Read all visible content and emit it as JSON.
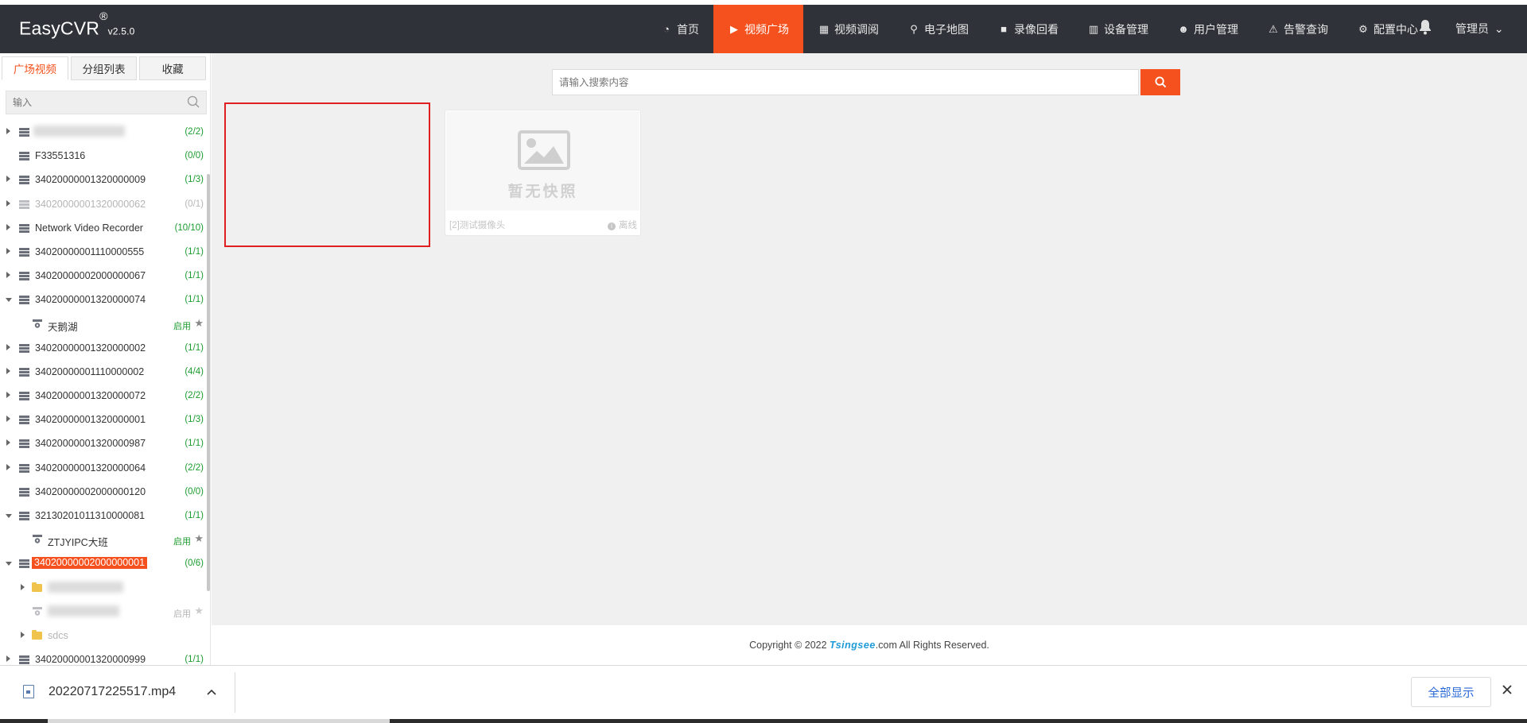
{
  "app": {
    "name": "EasyCVR",
    "reg": "®",
    "version": "v2.5.0"
  },
  "nav": [
    {
      "label": "首页",
      "icon": "dashboard-icon",
      "glyph": "◔"
    },
    {
      "label": "视频广场",
      "icon": "play-circle-icon",
      "glyph": "▶",
      "active": true
    },
    {
      "label": "视频调阅",
      "icon": "table-icon",
      "glyph": "▦"
    },
    {
      "label": "电子地图",
      "icon": "map-pin-icon",
      "glyph": "⚲"
    },
    {
      "label": "录像回看",
      "icon": "video-camera-icon",
      "glyph": "■"
    },
    {
      "label": "设备管理",
      "icon": "columns-icon",
      "glyph": "▥"
    },
    {
      "label": "用户管理",
      "icon": "user-icon",
      "glyph": "☻"
    },
    {
      "label": "告警查询",
      "icon": "alarm-light-icon",
      "glyph": "⚠"
    },
    {
      "label": "配置中心",
      "icon": "gear-icon",
      "glyph": "⚙"
    }
  ],
  "user_menu": {
    "label": "管理员",
    "caret": "⌄"
  },
  "sidebar": {
    "tabs": [
      {
        "label": "广场视频",
        "active": true
      },
      {
        "label": "分组列表"
      },
      {
        "label": "收藏"
      }
    ],
    "search_placeholder": "输入",
    "tree": [
      {
        "type": "device",
        "label": "",
        "count": "(2/2)",
        "expanded": false,
        "blurred": true
      },
      {
        "type": "device",
        "label": "F33551316",
        "count": "(0/0)",
        "leaf": true
      },
      {
        "type": "device",
        "label": "34020000001320000009",
        "count": "(1/3)"
      },
      {
        "type": "device",
        "label": "34020000001320000062",
        "count": "(0/1)",
        "dim": true
      },
      {
        "type": "device",
        "label": "Network Video Recorder",
        "count": "(10/10)"
      },
      {
        "type": "device",
        "label": "34020000001110000555",
        "count": "(1/1)"
      },
      {
        "type": "device",
        "label": "34020000002000000067",
        "count": "(1/1)"
      },
      {
        "type": "device",
        "label": "34020000001320000074",
        "count": "(1/1)",
        "expanded": true
      },
      {
        "type": "camera",
        "label": "天鹅湖",
        "status": "启用"
      },
      {
        "type": "device",
        "label": "34020000001320000002",
        "count": "(1/1)"
      },
      {
        "type": "device",
        "label": "34020000001110000002",
        "count": "(4/4)"
      },
      {
        "type": "device",
        "label": "34020000001320000072",
        "count": "(2/2)"
      },
      {
        "type": "device",
        "label": "34020000001320000001",
        "count": "(1/3)"
      },
      {
        "type": "device",
        "label": "34020000001320000987",
        "count": "(1/1)"
      },
      {
        "type": "device",
        "label": "34020000001320000064",
        "count": "(2/2)"
      },
      {
        "type": "device",
        "label": "34020000002000000120",
        "count": "(0/0)",
        "leaf": true
      },
      {
        "type": "device",
        "label": "32130201011310000081",
        "count": "(1/1)",
        "expanded": true
      },
      {
        "type": "camera",
        "label": "ZTJYIPC大班",
        "status": "启用"
      },
      {
        "type": "device",
        "label": "34020000002000000001",
        "count": "(0/6)",
        "expanded": true,
        "selected": true
      },
      {
        "type": "folder",
        "label": "",
        "blurred": true
      },
      {
        "type": "camera2",
        "label": "",
        "status": "启用",
        "dim": true,
        "blurred": true
      },
      {
        "type": "folder",
        "label": "sdcs",
        "dim": true
      },
      {
        "type": "device",
        "label": "34020000001320000999",
        "count": "(1/1)",
        "cut": true
      }
    ]
  },
  "main": {
    "search_placeholder": "请输入搜索内容",
    "cards": [
      {
        "name": "[2]测试摄像头",
        "status": "离线",
        "snapshot_text": "暂无快照"
      }
    ]
  },
  "footer": {
    "prefix": "Copyright © 2022 ",
    "brand": "Tsingsee",
    "suffix": ".com All Rights Reserved."
  },
  "download_bar": {
    "filename": "20220717225517.mp4",
    "show_all": "全部显示"
  },
  "colors": {
    "accent": "#f4511e",
    "header_bg": "#2f3238",
    "ok_green": "#1b9c2f",
    "highlight_box": "#e02020"
  }
}
